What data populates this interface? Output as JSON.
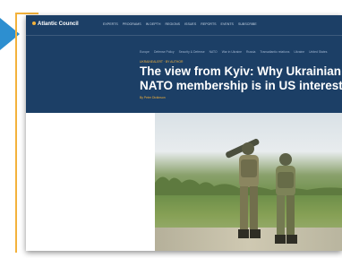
{
  "site": {
    "logo_text": "Atlantic Council"
  },
  "nav": {
    "items": [
      "EXPERTS",
      "PROGRAMS",
      "IN DEPTH",
      "REGIONS",
      "ISSUES",
      "REPORTS",
      "EVENTS",
      "SUBSCRIBE"
    ]
  },
  "subnav": {
    "items": [
      "Europe",
      "Defense Policy",
      "Security & Defense",
      "NATO",
      "War in Ukraine",
      "Russia",
      "Transatlantic relations",
      "Ukraine",
      "United States"
    ]
  },
  "article": {
    "tag": "UKRAINEALERT · BY AUTHOR",
    "title_line1": "The view from Kyiv: Why Ukrainian",
    "title_line2": "NATO membership is in US interest",
    "byline": "By Peter Dickinson"
  },
  "colors": {
    "hero_background": "#1c3f66",
    "accent": "#f3b23b",
    "frame_triangle": "#2d8fd0"
  }
}
